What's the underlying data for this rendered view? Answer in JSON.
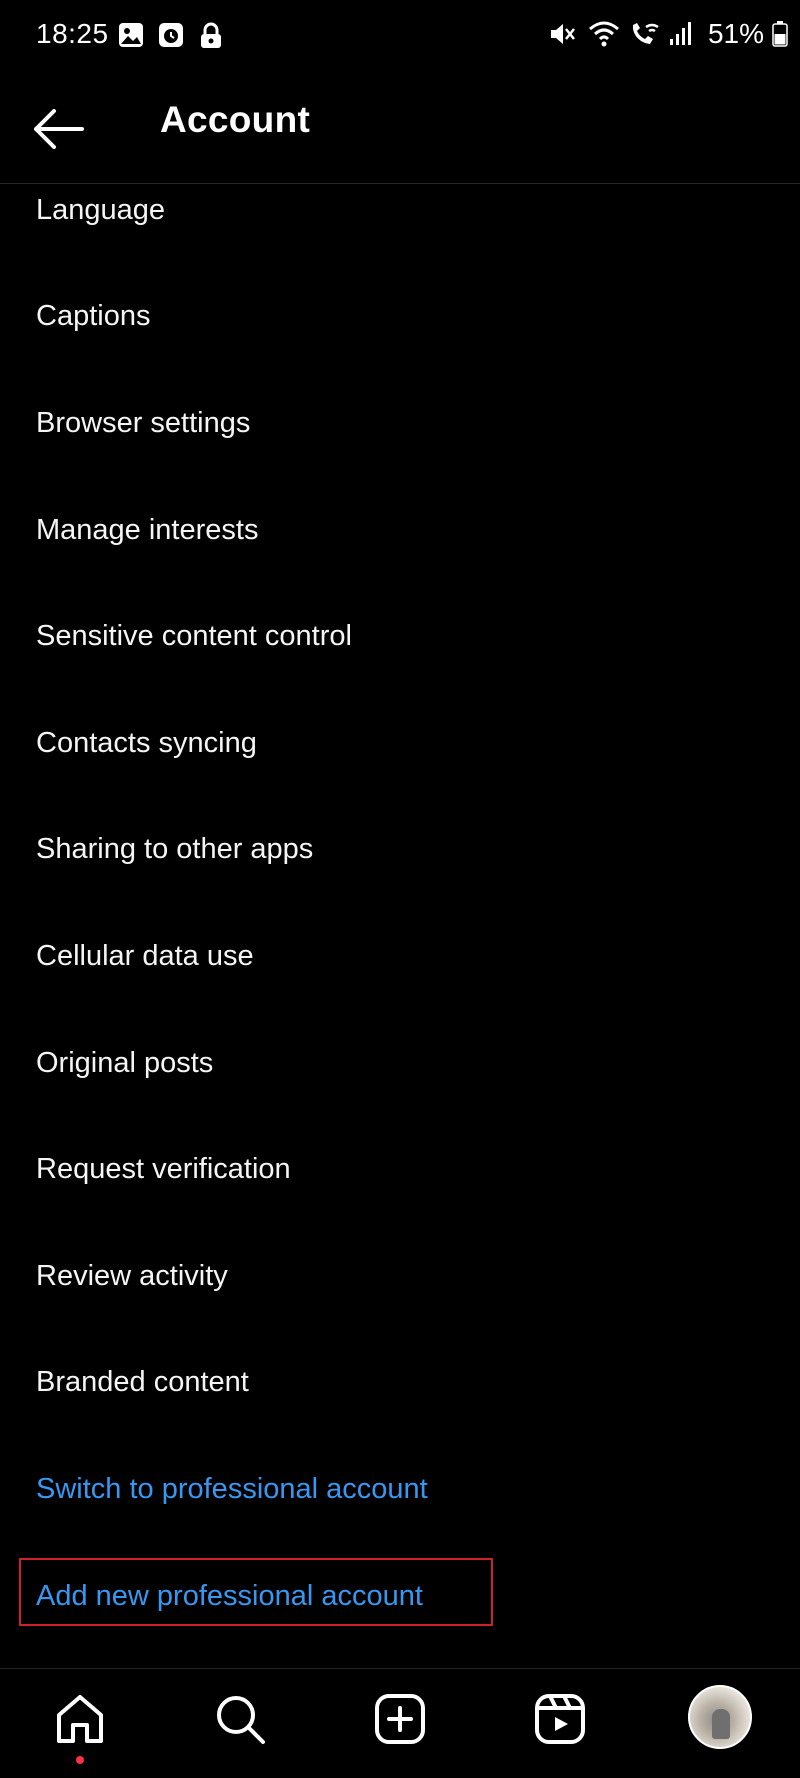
{
  "status_bar": {
    "time": "18:25",
    "battery": "51%",
    "icons_left": [
      "gallery-icon",
      "alarm-icon",
      "lock-icon"
    ],
    "icons_right": [
      "mute-icon",
      "wifi-icon",
      "wifi-calling-icon",
      "signal-icon",
      "battery-icon"
    ]
  },
  "header": {
    "title": "Account",
    "back_icon": "arrow-left-icon"
  },
  "settings": {
    "items": [
      {
        "label": "Language"
      },
      {
        "label": "Captions"
      },
      {
        "label": "Browser settings"
      },
      {
        "label": "Manage interests"
      },
      {
        "label": "Sensitive content control"
      },
      {
        "label": "Contacts syncing"
      },
      {
        "label": "Sharing to other apps"
      },
      {
        "label": "Cellular data use"
      },
      {
        "label": "Original posts"
      },
      {
        "label": "Request verification"
      },
      {
        "label": "Review activity"
      },
      {
        "label": "Branded content"
      },
      {
        "label": "Switch to professional account"
      },
      {
        "label": "Add new professional account"
      }
    ]
  },
  "bottom_nav": {
    "items": [
      "home-icon",
      "search-icon",
      "create-icon",
      "reels-icon",
      "profile-avatar"
    ]
  },
  "colors": {
    "background": "#000000",
    "text": "#f5f5f5",
    "link": "#3897f0",
    "highlight": "#d0202e",
    "notification": "#ff3040"
  }
}
